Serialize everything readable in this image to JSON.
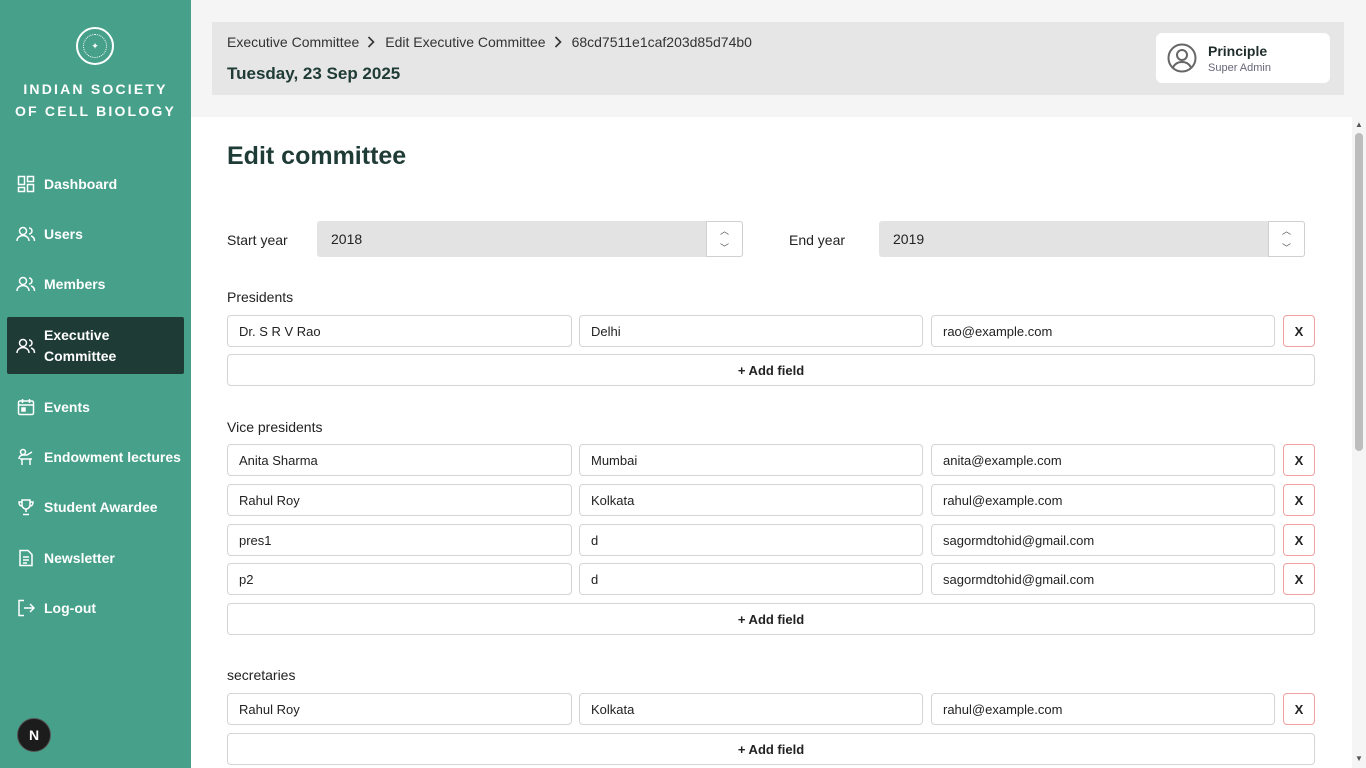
{
  "brand": {
    "line1": "INDIAN SOCIETY",
    "line2": "OF CELL BIOLOGY"
  },
  "nav": [
    {
      "label": "Dashboard",
      "icon": "dashboard-icon"
    },
    {
      "label": "Users",
      "icon": "users-icon"
    },
    {
      "label": "Members",
      "icon": "members-icon"
    },
    {
      "label": "Executive Committee",
      "icon": "executive-icon",
      "active": true
    },
    {
      "label": "Events",
      "icon": "calendar-icon"
    },
    {
      "label": "Endowment lectures",
      "icon": "lecture-icon"
    },
    {
      "label": "Student Awardee",
      "icon": "trophy-icon"
    },
    {
      "label": "Newsletter",
      "icon": "newsletter-icon"
    },
    {
      "label": "Log-out",
      "icon": "logout-icon"
    }
  ],
  "nav_exec_line1": "Executive",
  "nav_exec_line2": "Committee",
  "bottom_badge": "N",
  "header": {
    "breadcrumbs": [
      "Executive Committee",
      "Edit Executive Committee",
      "68cd7511e1caf203d85d74b0"
    ],
    "date": "Tuesday, 23 Sep 2025",
    "user": {
      "name": "Principle",
      "role": "Super Admin"
    }
  },
  "form": {
    "title": "Edit committee",
    "start_year_label": "Start year",
    "start_year": "2018",
    "end_year_label": "End year",
    "end_year": "2019",
    "remove_label": "X",
    "add_label": "+ Add field",
    "sections": [
      {
        "label": "Presidents",
        "rows": [
          {
            "name": "Dr. S R V Rao",
            "city": "Delhi",
            "email": "rao@example.com"
          }
        ]
      },
      {
        "label": "Vice presidents",
        "rows": [
          {
            "name": "Anita Sharma",
            "city": "Mumbai",
            "email": "anita@example.com"
          },
          {
            "name": "Rahul Roy",
            "city": "Kolkata",
            "email": "rahul@example.com"
          },
          {
            "name": "pres1",
            "city": "d",
            "email": "sagormdtohid@gmail.com"
          },
          {
            "name": "p2",
            "city": "d",
            "email": "sagormdtohid@gmail.com"
          }
        ]
      },
      {
        "label": "secretaries",
        "rows": [
          {
            "name": "Rahul Roy",
            "city": "Kolkata",
            "email": "rahul@example.com"
          }
        ]
      }
    ]
  },
  "colors": {
    "sidebar": "#46a08a",
    "active": "#1f3b35",
    "remove_border": "#f0a0a0"
  }
}
